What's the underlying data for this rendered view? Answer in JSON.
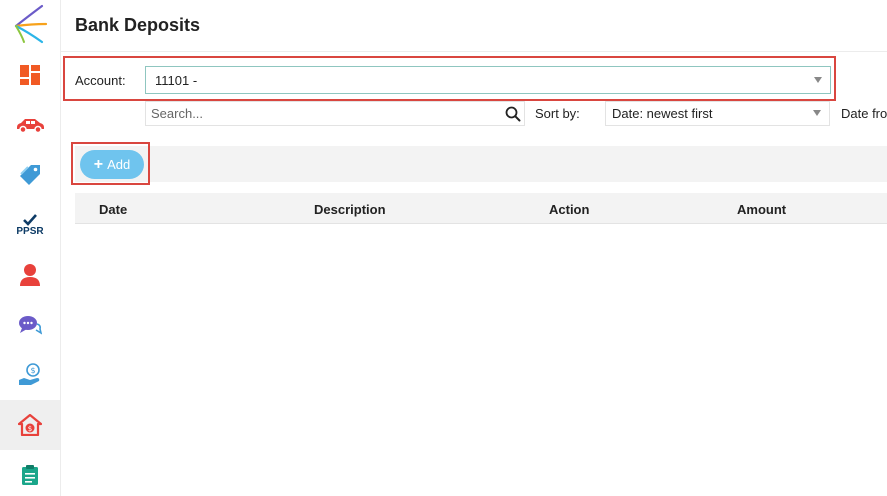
{
  "page": {
    "title": "Bank Deposits"
  },
  "sidebar": {
    "items": [
      {
        "name": "dashboard",
        "icon": "dashboard-icon",
        "color": "#f15a24"
      },
      {
        "name": "vehicles",
        "icon": "car-icon",
        "color": "#e8413b"
      },
      {
        "name": "tags",
        "icon": "tag-icon",
        "color": "#3f9ad6"
      },
      {
        "name": "ppsr",
        "icon": "ppsr-icon",
        "label": "PPSR",
        "color": "#0d3b66"
      },
      {
        "name": "contacts",
        "icon": "person-icon",
        "color": "#e8413b"
      },
      {
        "name": "messages",
        "icon": "chat-icon",
        "color": "#6b5bc8"
      },
      {
        "name": "payments",
        "icon": "hand-dollar-icon",
        "color": "#3f9ad6"
      },
      {
        "name": "bank-deposits",
        "icon": "house-dollar-icon",
        "color": "#e8413b",
        "active": true
      },
      {
        "name": "reports",
        "icon": "clipboard-icon",
        "color": "#1aa68a"
      }
    ]
  },
  "account": {
    "label": "Account:",
    "value": "11101 -"
  },
  "search": {
    "placeholder": "Search..."
  },
  "sort": {
    "label": "Sort by:",
    "value": "Date: newest first"
  },
  "date_filter": {
    "label": "Date from"
  },
  "toolbar": {
    "add_label": "Add"
  },
  "table": {
    "columns": [
      "Date",
      "Description",
      "Action",
      "Amount"
    ]
  },
  "colors": {
    "highlight": "#d9463f",
    "add_button": "#6fc4ee",
    "select_border": "#8fc6c0"
  }
}
